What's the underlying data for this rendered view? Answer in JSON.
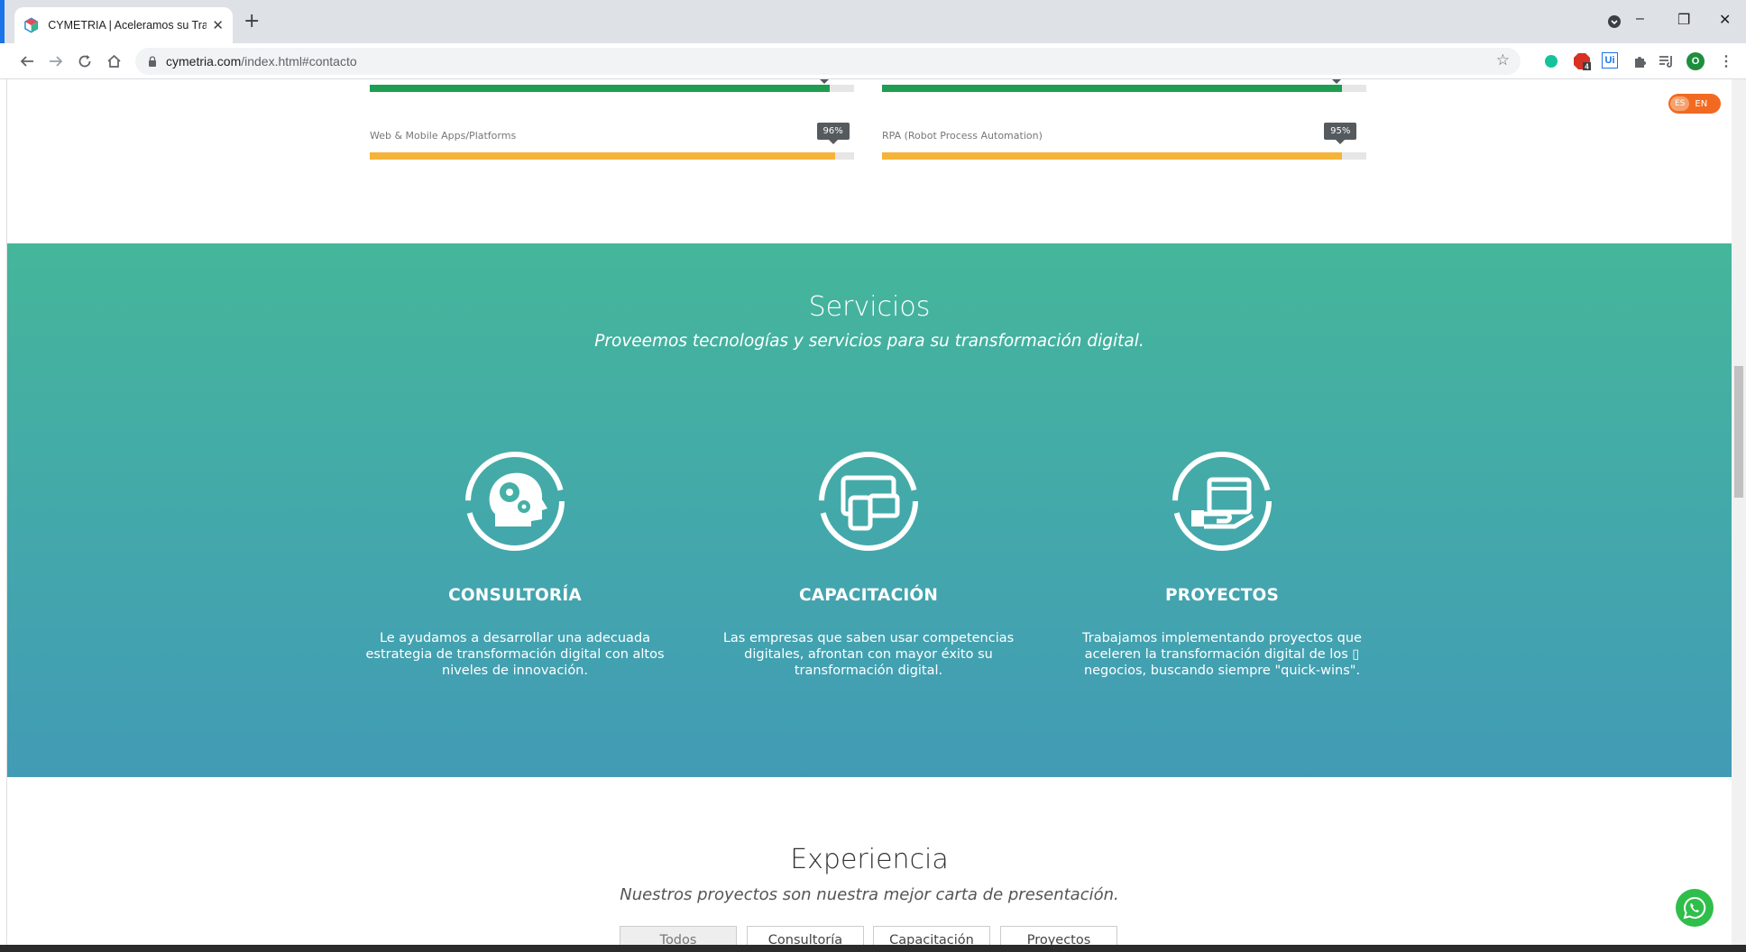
{
  "browser": {
    "tab_title": "CYMETRIA | Aceleramos su Trans",
    "url_domain": "cymetria.com",
    "url_rest": "/index.html#contacto",
    "window_controls": {
      "minimize": "–",
      "restore": "❐",
      "close": "✕"
    },
    "extensions": [
      {
        "name": "grammarly-icon",
        "color": "#15c39a"
      },
      {
        "name": "adblock-icon",
        "color": "#d93025",
        "badge": "4"
      },
      {
        "name": "uipath-icon",
        "color": "#1a73e8",
        "label": "Ui"
      },
      {
        "name": "extensions-puzzle-icon",
        "color": "#5f6368"
      },
      {
        "name": "reading-list-icon",
        "color": "#5f6368"
      },
      {
        "name": "profile-avatar",
        "color": "#1e8e3e",
        "label": "O"
      }
    ]
  },
  "skills": [
    {
      "label": "",
      "percent": 95,
      "tip": "",
      "color": "#1e9e51",
      "column": "left",
      "partial": true
    },
    {
      "label": "",
      "percent": 95,
      "tip": "",
      "color": "#1e9e51",
      "column": "right",
      "partial": true
    },
    {
      "label": "Web & Mobile Apps/Platforms",
      "percent": 96,
      "tip": "96%",
      "color": "#f6b33a",
      "column": "left"
    },
    {
      "label": "RPA (Robot Process Automation)",
      "percent": 95,
      "tip": "95%",
      "color": "#f6b33a",
      "column": "right"
    }
  ],
  "language": {
    "es": "ES",
    "en": "EN"
  },
  "services": {
    "title": "Servicios",
    "subtitle": "Proveemos tecnologías y servicios para su transformación digital.",
    "items": [
      {
        "icon": "head-gears-icon",
        "title": "CONSULTORÍA",
        "description": "Le ayudamos a desarrollar una adecuada estrategia de transformación digital con altos niveles de innovación."
      },
      {
        "icon": "devices-icon",
        "title": "CAPACITACIÓN",
        "description": "Las empresas que saben usar competencias digitales, afrontan con mayor éxito su transformación digital."
      },
      {
        "icon": "hand-browser-icon",
        "title": "PROYECTOS",
        "description": "Trabajamos implementando proyectos que aceleren la transformación digital de los ▯ negocios, buscando siempre \"quick-wins\"."
      }
    ]
  },
  "experience": {
    "title": "Experiencia",
    "subtitle": "Nuestros proyectos son nuestra mejor carta de presentación.",
    "filters": [
      "Todos",
      "Consultoría",
      "Capacitación",
      "Proyectos"
    ],
    "active_filter": "Todos"
  }
}
